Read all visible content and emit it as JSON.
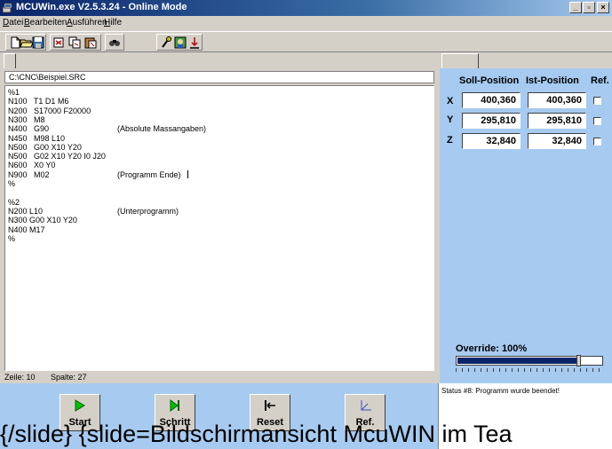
{
  "window": {
    "title": "MCUWin.exe V2.5.3.24 - Online Mode"
  },
  "menu": [
    "Datei",
    "Bearbeiten",
    "Ausführen",
    "Hilfe"
  ],
  "toolbar": {
    "icons": [
      "new-file-icon",
      "open-file-icon",
      "save-file-icon",
      "cut-icon",
      "copy-icon",
      "paste-icon",
      "find-icon",
      "settings-icon",
      "user-icon",
      "download-icon"
    ]
  },
  "editor": {
    "path": "C:\\CNC\\Beispiel.SRC",
    "lines": [
      {
        "code": "%1",
        "comment": ""
      },
      {
        "code": "N100   T1 D1 M6",
        "comment": ""
      },
      {
        "code": "N200   S17000 F20000",
        "comment": ""
      },
      {
        "code": "N300   M8",
        "comment": ""
      },
      {
        "code": "N400   G90",
        "comment": "(Absolute Massangaben)"
      },
      {
        "code": "N450   M98 L10",
        "comment": ""
      },
      {
        "code": "N500   G00 X10 Y20",
        "comment": ""
      },
      {
        "code": "N500   G02 X10 Y20 I0 J20",
        "comment": ""
      },
      {
        "code": "N600   X0 Y0",
        "comment": ""
      },
      {
        "code": "N900   M02",
        "comment": "(Programm Ende)"
      },
      {
        "code": "%",
        "comment": ""
      },
      {
        "code": "",
        "comment": ""
      },
      {
        "code": "%2",
        "comment": ""
      },
      {
        "code": "N200 L10",
        "comment": "(Unterprogramm)"
      },
      {
        "code": "N300 G00 X10 Y20",
        "comment": ""
      },
      {
        "code": "N400 M17",
        "comment": ""
      },
      {
        "code": "%",
        "comment": ""
      }
    ],
    "status_line": "Zeile:  10",
    "status_col": "Spalte:  27"
  },
  "positions": {
    "headers": {
      "soll": "Soll-Position",
      "ist": "Ist-Position",
      "ref": "Ref."
    },
    "axes": [
      {
        "axis": "X",
        "soll": "400,360",
        "ist": "400,360"
      },
      {
        "axis": "Y",
        "soll": "295,810",
        "ist": "295,810"
      },
      {
        "axis": "Z",
        "soll": "32,840",
        "ist": "32,840"
      }
    ]
  },
  "override": {
    "label": "Override: 100%",
    "value_fraction": 0.83
  },
  "buttons": {
    "start": {
      "label": "Start",
      "color": "#00c000"
    },
    "step": {
      "label": "Schritt",
      "color": "#00a000"
    },
    "reset": {
      "label": "Reset",
      "color": "#000000"
    },
    "ref": {
      "label": "Ref.",
      "color": "#3050c0"
    }
  },
  "status": {
    "message": "Status #8: Programm wurde beendet!"
  },
  "caption": {
    "text": "{/slide} {slide=Bildschirmansicht McuWIN im Tea"
  },
  "colors": {
    "panel_blue": "#a6caf0",
    "titlebar": "#0a246a",
    "face": "#d4d0c8"
  }
}
